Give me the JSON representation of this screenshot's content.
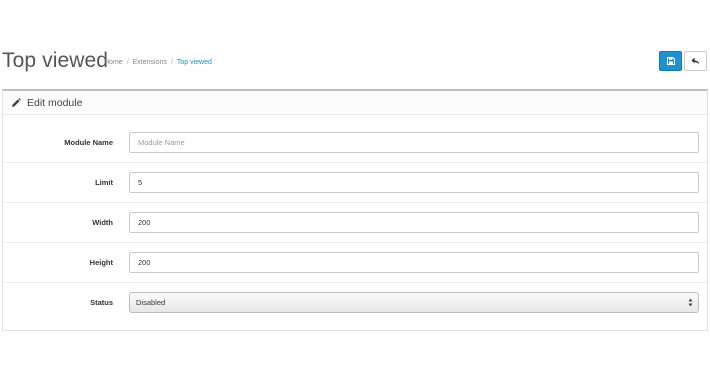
{
  "header": {
    "title": "Top viewed",
    "breadcrumb": [
      {
        "label": "Home"
      },
      {
        "label": "Extensions"
      },
      {
        "label": "Top viewed"
      }
    ]
  },
  "toolbar": {
    "save_icon": "save-icon",
    "back_icon": "reply-icon",
    "accent_color": "#1e91cf"
  },
  "panel": {
    "icon": "pencil-icon",
    "title": "Edit module"
  },
  "form": {
    "module_name": {
      "label": "Module Name",
      "value": "",
      "placeholder": "Module Name"
    },
    "limit": {
      "label": "Limit",
      "value": "5"
    },
    "width": {
      "label": "Width",
      "value": "200"
    },
    "height": {
      "label": "Height",
      "value": "200"
    },
    "status": {
      "label": "Status",
      "selected": "Disabled"
    }
  }
}
